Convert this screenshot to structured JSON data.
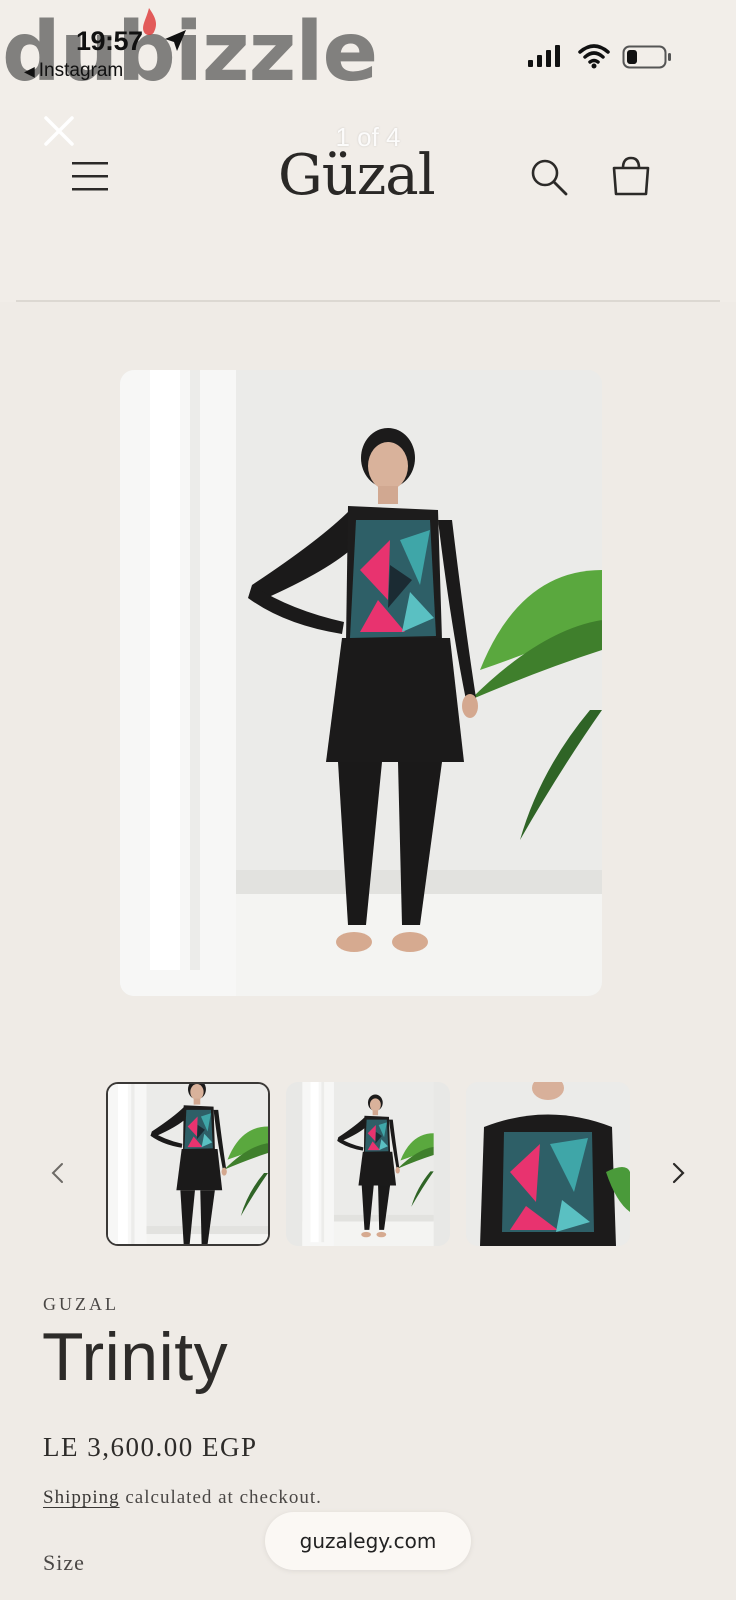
{
  "status_bar": {
    "time": "19:57",
    "back_app": "Instagram",
    "watermark": "dubizzle"
  },
  "viewer": {
    "pager": "1 of 4"
  },
  "store": {
    "brand": "Güzal"
  },
  "gallery": {
    "images": [
      "model-full-body-photo",
      "model-full-body-photo",
      "model-full-body-photo",
      "model-closeup-photo"
    ],
    "active_index": 0
  },
  "product": {
    "vendor": "GUZAL",
    "title": "Trinity",
    "price": "LE 3,600.00 EGP",
    "shipping_link": "Shipping",
    "shipping_rest": "calculated at checkout.",
    "size_label": "Size"
  },
  "browser": {
    "url": "guzalegy.com"
  },
  "colors": {
    "background": "#efebe6",
    "text": "#2c2a28",
    "swimsuit_pink": "#e8336f",
    "swimsuit_teal": "#3fa6a8",
    "leaf_green": "#4a9a3a"
  }
}
